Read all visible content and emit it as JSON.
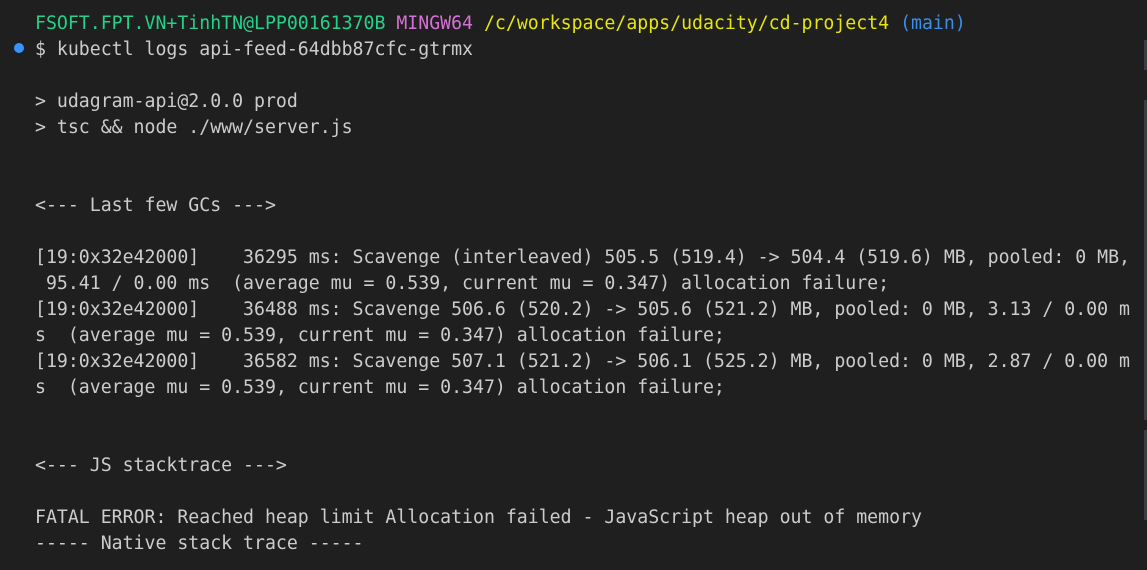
{
  "prompt": {
    "user": "FSOFT.FPT.VN+TinhTN@LPP00161370B",
    "shell": "MINGW64",
    "path": "/c/workspace/apps/udacity/cd-project4",
    "branch": "(main)"
  },
  "command": "$ kubectl logs api-feed-64dbb87cfc-gtrmx",
  "output": {
    "npm_line_1": "> udagram-api@2.0.0 prod",
    "npm_line_2": "> tsc && node ./www/server.js",
    "gc_header": "<--- Last few GCs --->",
    "gc_lines": [
      "[19:0x32e42000]    36295 ms: Scavenge (interleaved) 505.5 (519.4) -> 504.4 (519.6) MB, pooled: 0 MB,",
      " 95.41 / 0.00 ms  (average mu = 0.539, current mu = 0.347) allocation failure;",
      "[19:0x32e42000]    36488 ms: Scavenge 506.6 (520.2) -> 505.6 (521.2) MB, pooled: 0 MB, 3.13 / 0.00 m",
      "s  (average mu = 0.539, current mu = 0.347) allocation failure;",
      "[19:0x32e42000]    36582 ms: Scavenge 507.1 (521.2) -> 506.1 (525.2) MB, pooled: 0 MB, 2.87 / 0.00 m",
      "s  (average mu = 0.539, current mu = 0.347) allocation failure;"
    ],
    "js_header": "<--- JS stacktrace --->",
    "fatal": "FATAL ERROR: Reached heap limit Allocation failed - JavaScript heap out of memory",
    "native_trace": "----- Native stack trace -----"
  },
  "colors": {
    "background": "#1f1f1f",
    "foreground": "#cccccc",
    "user": "#23d18b",
    "shell": "#d670d6",
    "path": "#e5e510",
    "branch": "#3b8eea",
    "marker": "#3794ff"
  }
}
